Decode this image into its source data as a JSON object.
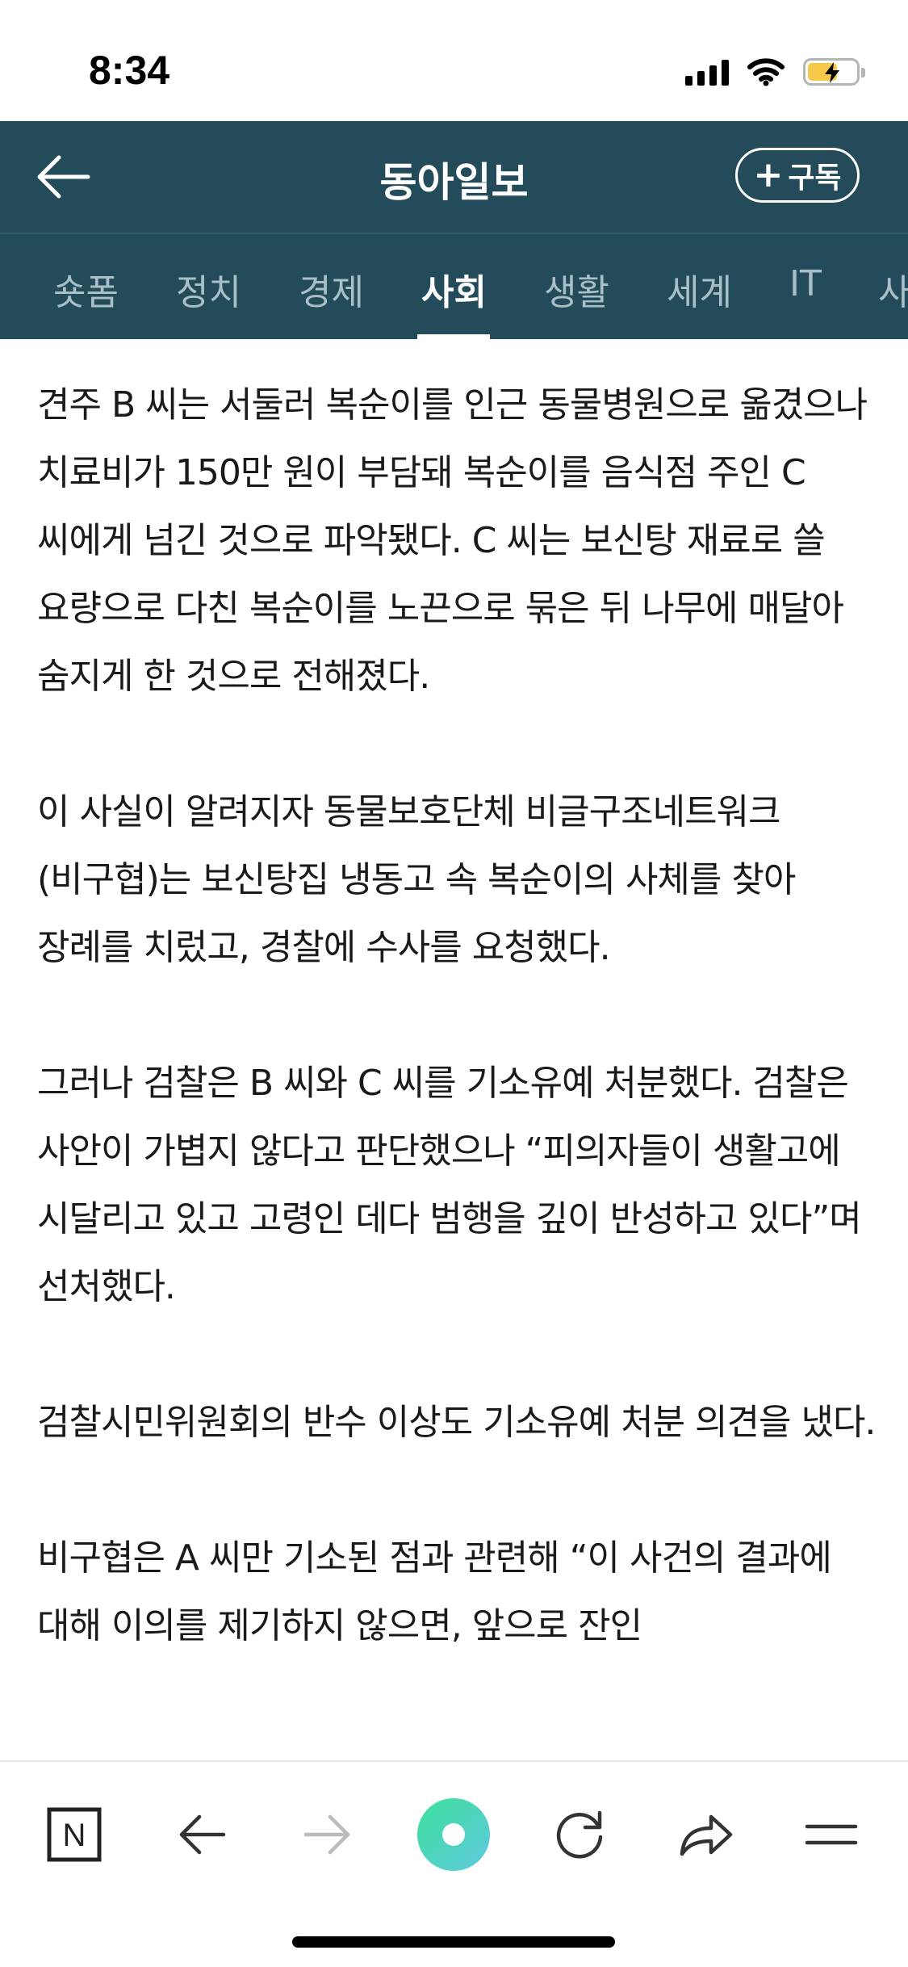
{
  "status_bar": {
    "time": "8:34"
  },
  "header": {
    "title": "동아일보",
    "subscribe_label": "구독",
    "subscribe_plus": "+"
  },
  "tabs": [
    {
      "label": "숏폼",
      "active": false
    },
    {
      "label": "정치",
      "active": false
    },
    {
      "label": "경제",
      "active": false
    },
    {
      "label": "사회",
      "active": true
    },
    {
      "label": "생활",
      "active": false
    },
    {
      "label": "세계",
      "active": false
    },
    {
      "label": "IT",
      "active": false
    },
    {
      "label": "사",
      "active": false
    }
  ],
  "article": {
    "paragraphs": [
      "견주 B 씨는 서둘러 복순이를 인근 동물병원으로 옮겼으나 치료비가 150만 원이 부담돼 복순이를 음식점 주인 C 씨에게 넘긴 것으로 파악됐다. C 씨는 보신탕 재료로 쓸 요량으로 다친 복순이를 노끈으로 묶은 뒤 나무에 매달아 숨지게 한 것으로 전해졌다.",
      "이 사실이 알려지자 동물보호단체 비글구조네트워크(비구협)는 보신탕집 냉동고 속 복순이의 사체를 찾아 장례를 치렀고, 경찰에 수사를 요청했다.",
      "그러나 검찰은 B 씨와 C 씨를 기소유예 처분했다. 검찰은 사안이 가볍지 않다고 판단했으나 “피의자들이 생활고에 시달리고 있고 고령인 데다 범행을 깊이 반성하고 있다”며 선처했다.",
      "검찰시민위원회의 반수 이상도 기소유예 처분 의견을 냈다.",
      "비구협은 A 씨만 기소된 점과 관련해 “이 사건의 결과에 대해 이의를 제기하지 않으면, 앞으로 잔인"
    ]
  },
  "toolbar": {
    "items": [
      "naver-n-icon",
      "back-arrow-icon",
      "forward-arrow-icon",
      "green-dot-icon",
      "refresh-icon",
      "share-icon",
      "menu-icon"
    ],
    "naver_letter": "N",
    "colors": {
      "green_start": "#3ee09b",
      "green_end": "#5fc9e0",
      "header_bg": "#234b5a"
    }
  }
}
